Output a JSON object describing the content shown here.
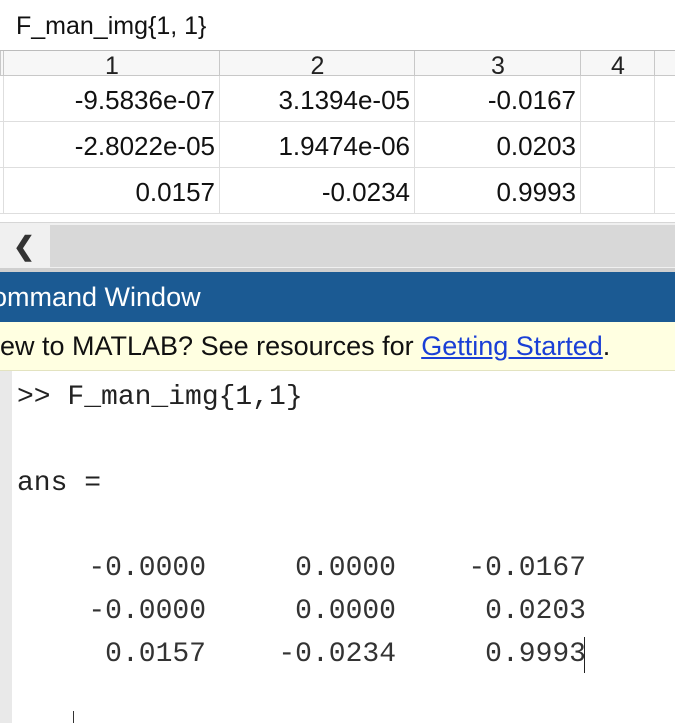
{
  "variable_editor": {
    "title": "F_man_img{1, 1}",
    "column_headers": [
      "1",
      "2",
      "3",
      "4"
    ],
    "rows": [
      [
        "-9.5836e-07",
        "3.1394e-05",
        "-0.0167",
        ""
      ],
      [
        "-2.8022e-05",
        "1.9474e-06",
        "0.0203",
        ""
      ],
      [
        "0.0157",
        "-0.0234",
        "0.9993",
        ""
      ]
    ],
    "scroll_left_glyph": "❮"
  },
  "command_window": {
    "title": "ommand Window",
    "banner": {
      "prefix": "lew to MATLAB? See resources for ",
      "link": "Getting Started",
      "suffix": "."
    },
    "command_line": ">> F_man_img{1,1}",
    "ans_label": "ans =",
    "output_rows": [
      [
        "-0.0000",
        "0.0000",
        "-0.0167"
      ],
      [
        "-0.0000",
        "0.0000",
        "0.0203"
      ],
      [
        "0.0157",
        "-0.0234",
        "0.9993"
      ]
    ]
  },
  "colors": {
    "command_title_bg": "#1b5a93",
    "banner_bg": "#ffffe1",
    "link": "#1a3fd6"
  }
}
